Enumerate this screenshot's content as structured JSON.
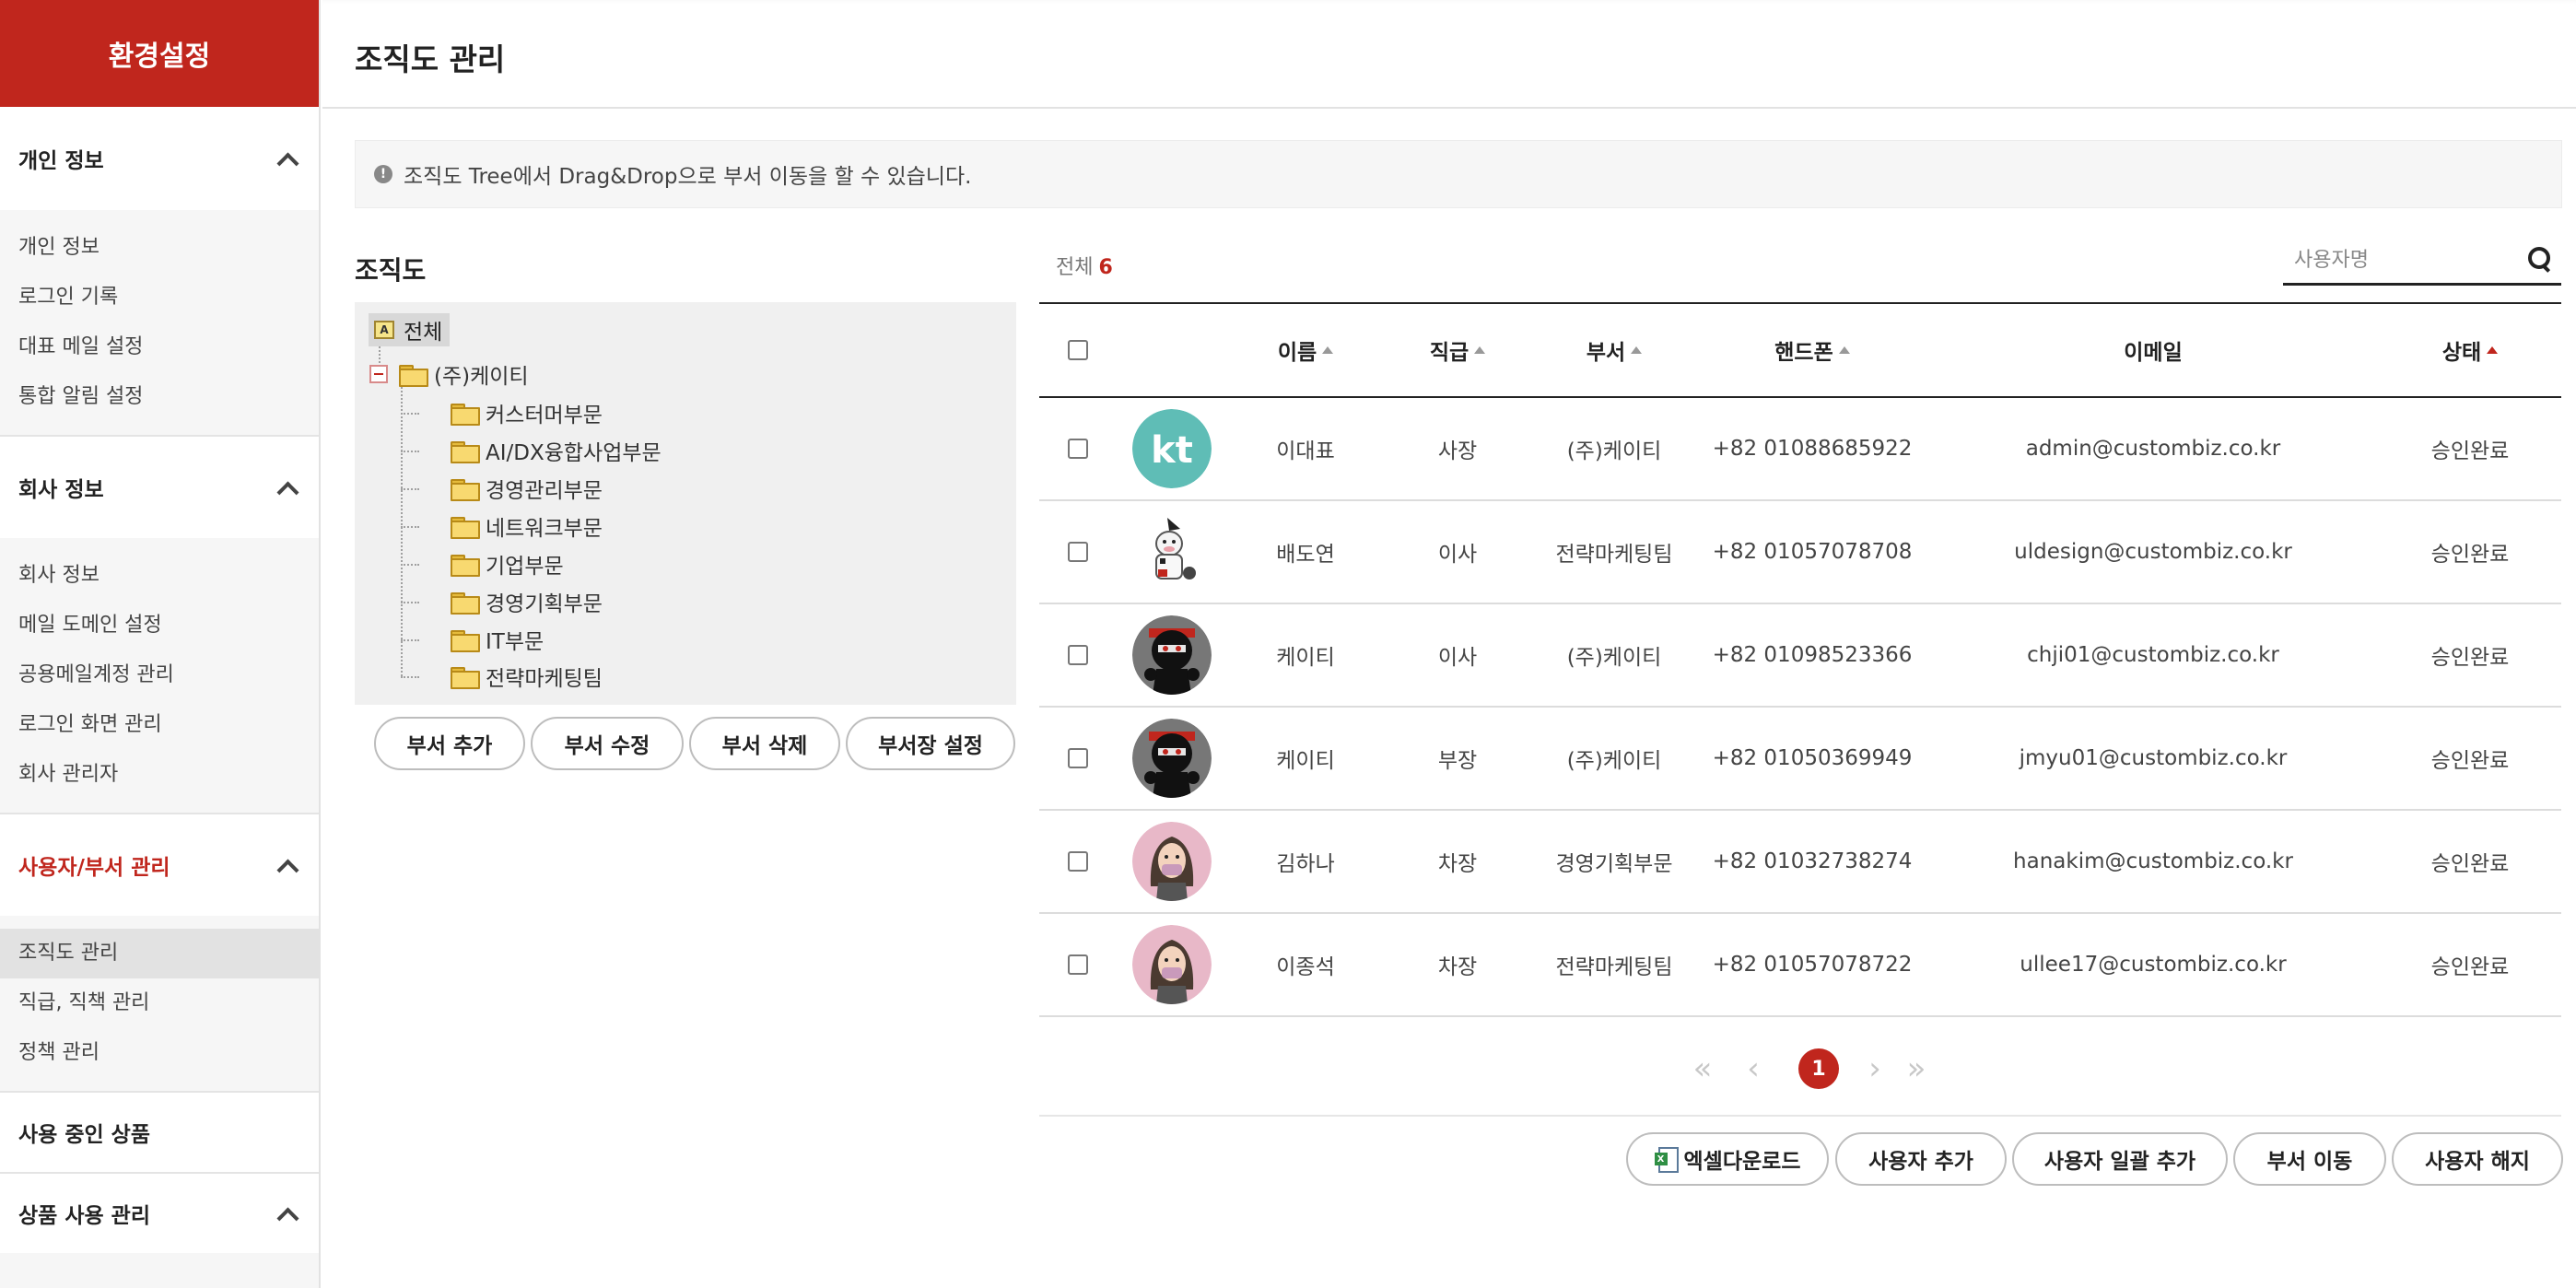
{
  "sidebar": {
    "brand": "환경설정",
    "sections": [
      {
        "title": "개인 정보",
        "items": [
          "개인 정보",
          "로그인 기록",
          "대표 메일 설정",
          "통합 알림 설정"
        ]
      },
      {
        "title": "회사 정보",
        "items": [
          "회사 정보",
          "메일 도메인 설정",
          "공용메일계정 관리",
          "로그인 화면 관리",
          "회사 관리자"
        ]
      },
      {
        "title": "사용자/부서 관리",
        "items": [
          "조직도 관리",
          "직급, 직책 관리",
          "정책 관리"
        ]
      },
      {
        "title": "사용 중인 상품"
      },
      {
        "title": "상품 사용 관리"
      }
    ]
  },
  "page": {
    "title": "조직도 관리"
  },
  "notice": {
    "icon": "info-icon",
    "text": "조직도 Tree에서 Drag&Drop으로 부서 이동을 할 수 있습니다."
  },
  "org": {
    "title": "조직도",
    "root": "전체",
    "company": "(주)케이티",
    "departments": [
      "커스터머부문",
      "AI/DX융합사업부문",
      "경영관리부문",
      "네트워크부문",
      "기업부문",
      "경영기획부문",
      "IT부문",
      "전략마케팅팀"
    ],
    "buttons": [
      "부서 추가",
      "부서 수정",
      "부서 삭제",
      "부서장 설정"
    ]
  },
  "users": {
    "total_label": "전체",
    "total_count": "6",
    "search_placeholder": "사용자명",
    "columns": [
      "이름",
      "직급",
      "부서",
      "핸드폰",
      "이메일",
      "상태"
    ],
    "rows": [
      {
        "avatar": "kt-logo",
        "name": "이대표",
        "rank": "사장",
        "dept": "(주)케이티",
        "phone": "+82 01088685922",
        "email": "admin@custombiz.co.kr",
        "status": "승인완료"
      },
      {
        "avatar": "cow-character",
        "name": "배도연",
        "rank": "이사",
        "dept": "전략마케팅팀",
        "phone": "+82 01057078708",
        "email": "uldesign@custombiz.co.kr",
        "status": "승인완료"
      },
      {
        "avatar": "ninja-character",
        "name": "케이티",
        "rank": "이사",
        "dept": "(주)케이티",
        "phone": "+82 01098523366",
        "email": "chji01@custombiz.co.kr",
        "status": "승인완료"
      },
      {
        "avatar": "ninja-character",
        "name": "케이티",
        "rank": "부장",
        "dept": "(주)케이티",
        "phone": "+82 01050369949",
        "email": "jmyu01@custombiz.co.kr",
        "status": "승인완료"
      },
      {
        "avatar": "masked-person",
        "name": "김하나",
        "rank": "차장",
        "dept": "경영기획부문",
        "phone": "+82 01032738274",
        "email": "hanakim@custombiz.co.kr",
        "status": "승인완료"
      },
      {
        "avatar": "masked-person",
        "name": "이종석",
        "rank": "차장",
        "dept": "전략마케팅팀",
        "phone": "+82 01057078722",
        "email": "ullee17@custombiz.co.kr",
        "status": "승인완료"
      }
    ],
    "pagination": {
      "first": "«",
      "prev": "‹",
      "current": "1",
      "next": "›",
      "last": "»"
    },
    "actions": [
      "엑셀다운로드",
      "사용자 추가",
      "사용자 일괄 추가",
      "부서 이동",
      "사용자 해지"
    ]
  },
  "colors": {
    "brand": "#c0261d",
    "kt_teal": "#5fbdb6",
    "avatar_pink": "#e8b8c8"
  }
}
